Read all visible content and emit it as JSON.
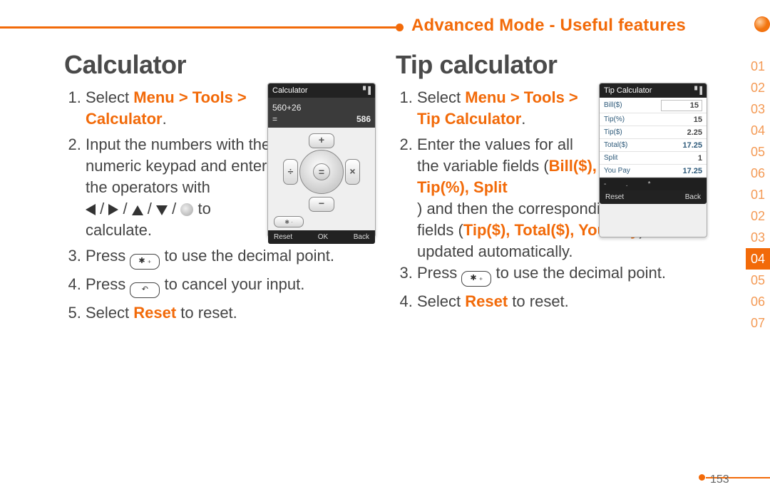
{
  "header": {
    "section_title": "Advanced Mode - Useful features"
  },
  "left": {
    "heading": "Calculator",
    "step1_prefix": "Select ",
    "step1_path": "Menu > Tools > Calculator",
    "step1_suffix": ".",
    "step2a": "Input the numbers with the numeric keypad and enter the operators with",
    "step2b": " to calculate.",
    "step3a": "Press ",
    "step3b": " to use the decimal point.",
    "step4a": "Press ",
    "step4b": " to cancel your input.",
    "step5a": "Select ",
    "step5_reset": "Reset",
    "step5b": " to reset."
  },
  "right": {
    "heading": "Tip calculator",
    "step1_prefix": "Select ",
    "step1_path": "Menu > Tools > Tip Calculator",
    "step1_suffix": ".",
    "step2a": "Enter the values for all the variable fields ",
    "step2_vars": "Bill($), Tip(%), Split",
    "step2b": ") and then the corresponding calculation fields (",
    "step2_outs": "Tip($), Total($), You Pay",
    "step2c": ") are updated automatically.",
    "step3a": "Press ",
    "step3b": " to use the decimal point.",
    "step4a": "Select ",
    "step4_reset": "Reset",
    "step4b": " to reset."
  },
  "calc_screen": {
    "title": "Calculator",
    "input": "560+26",
    "result": "586",
    "soft_left": "Reset",
    "soft_mid": "OK",
    "soft_right": "Back"
  },
  "tip_screen": {
    "title": "Tip Calculator",
    "rows": [
      {
        "label": "Bill($)",
        "value": "15",
        "boxed": true
      },
      {
        "label": "Tip(%)",
        "value": "15"
      },
      {
        "label": "Tip($)",
        "value": "2.25"
      },
      {
        "label": "Total($)",
        "value": "17.25",
        "blue": true
      },
      {
        "label": "Split",
        "value": "1"
      },
      {
        "label": "You Pay",
        "value": "17.25",
        "blue": true
      }
    ],
    "sym_row": [
      "-",
      ".",
      "*"
    ],
    "soft_left": "Reset",
    "soft_right": "Back"
  },
  "tabs": [
    {
      "label": "01",
      "current": false
    },
    {
      "label": "02",
      "current": false
    },
    {
      "label": "03",
      "current": false
    },
    {
      "label": "04",
      "current": false
    },
    {
      "label": "05",
      "current": false
    },
    {
      "label": "06",
      "current": false
    },
    {
      "label": "01",
      "current": false
    },
    {
      "label": "02",
      "current": false
    },
    {
      "label": "03",
      "current": false
    },
    {
      "label": "04",
      "current": true
    },
    {
      "label": "05",
      "current": false
    },
    {
      "label": "06",
      "current": false
    },
    {
      "label": "07",
      "current": false
    }
  ],
  "page_number": "153"
}
